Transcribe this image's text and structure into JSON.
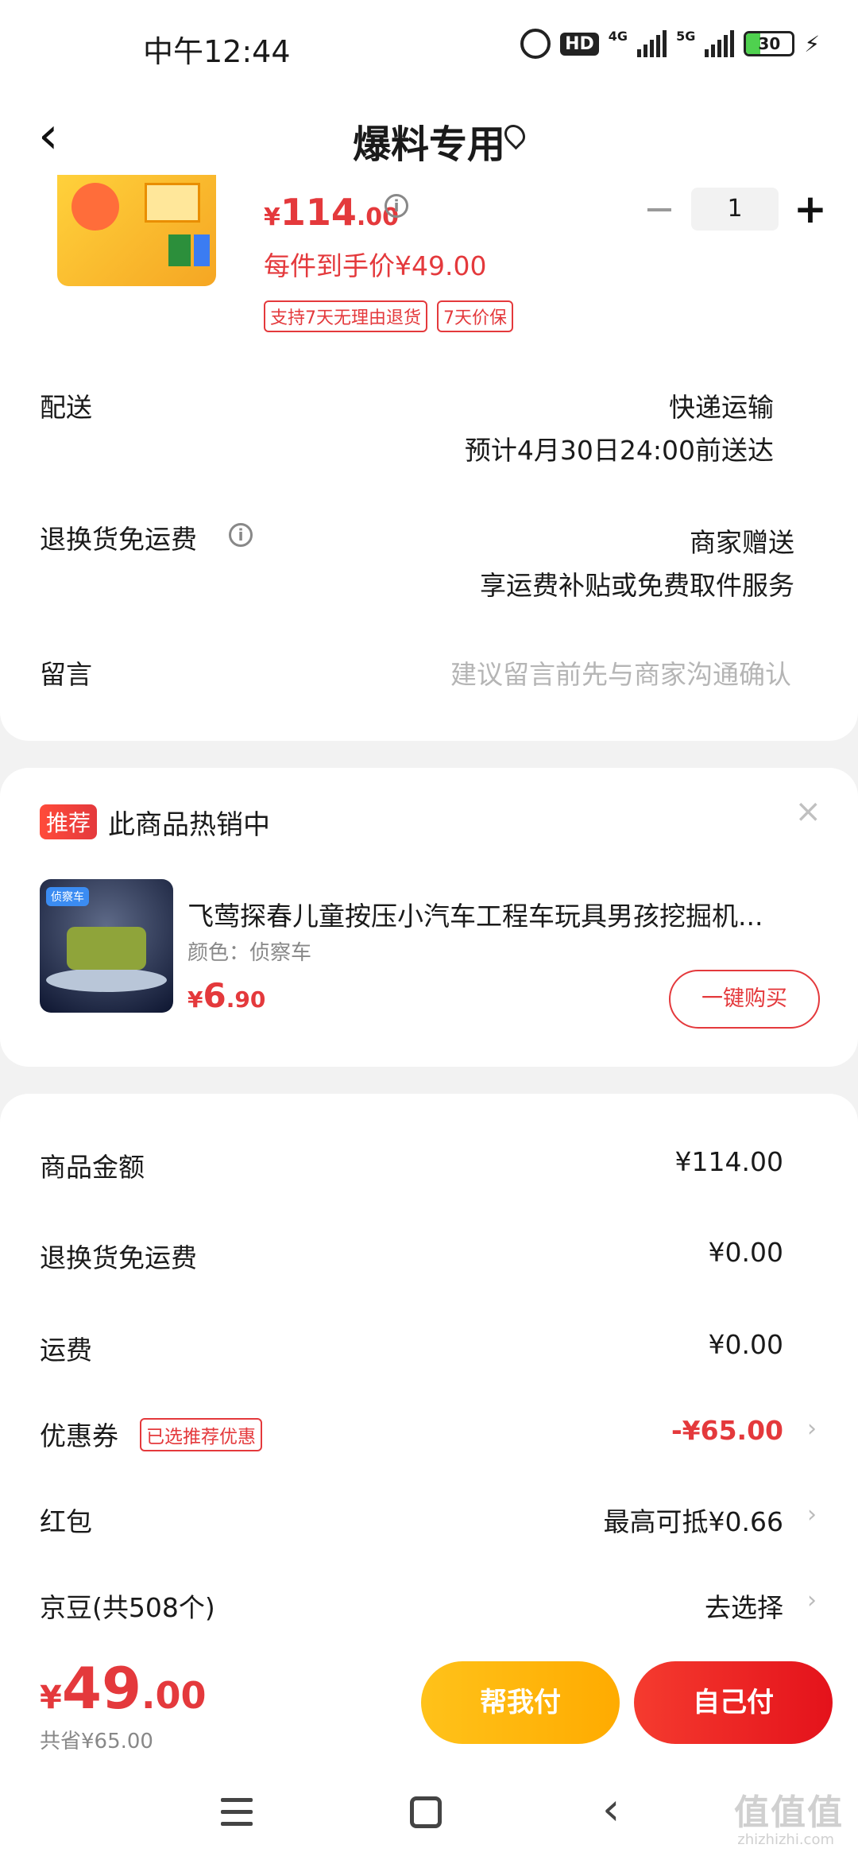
{
  "status_bar": {
    "time": "中午12:44",
    "hd_label": "HD",
    "net_4g": "4G",
    "net_5g": "5G",
    "battery": "30"
  },
  "nav": {
    "title": "爆料专用",
    "back_icon": "chevron-left-icon",
    "location_icon": "location-pin-icon"
  },
  "product": {
    "price_symbol": "¥",
    "price_int": "114",
    "price_dec": ".00",
    "per_item_price": "每件到手价¥49.00",
    "tags": [
      "支持7天无理由退货",
      "7天价保"
    ],
    "quantity": "1",
    "qty_minus": "−",
    "qty_plus": "+"
  },
  "order_rows": {
    "delivery_label": "配送",
    "delivery_method": "快递运输",
    "delivery_eta": "预计4月30日24:00前送达",
    "return_label": "退换货免运费",
    "return_value": "商家赠送",
    "return_sub": "享运费补贴或免费取件服务",
    "message_label": "留言",
    "message_placeholder": "建议留言前先与商家沟通确认"
  },
  "recommend": {
    "badge": "推荐",
    "title": "此商品热销中",
    "close": "×",
    "item_name": "飞莺探春儿童按压小汽车工程车玩具男孩挖掘机...",
    "item_color": "颜色：侦察车",
    "price_symbol": "¥",
    "price_int": "6",
    "price_dec": ".90",
    "buy_label": "一键购买",
    "image_label": "侦察车"
  },
  "fees": {
    "goods_label": "商品金额",
    "goods_value": "¥114.00",
    "return_fee_label": "退换货免运费",
    "return_fee_value": "¥0.00",
    "shipping_label": "运费",
    "shipping_value": "¥0.00",
    "coupon_label": "优惠券",
    "coupon_tag": "已选推荐优惠",
    "coupon_value": "-¥65.00",
    "redpacket_label": "红包",
    "redpacket_value": "最高可抵¥0.66",
    "jingdou_label": "京豆(共508个)",
    "jingdou_value": "去选择",
    "chevron": "›"
  },
  "bottom": {
    "total_symbol": "¥",
    "total_int": "49",
    "total_dec": ".00",
    "saved": "共省¥65.00",
    "help_pay": "帮我付",
    "self_pay": "自己付"
  },
  "watermark": {
    "logo": "值值值",
    "site": "zhizhizhi.com"
  },
  "colors": {
    "accent_red": "#e4393c",
    "help_pay_yellow": "#ffb400"
  }
}
